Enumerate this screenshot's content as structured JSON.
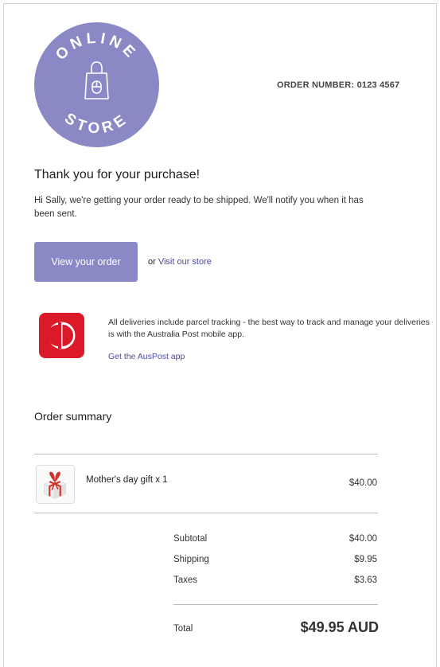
{
  "brand": {
    "logo_top_text": "ONLINE",
    "logo_bottom_text": "STORE",
    "logo_color": "#8a88c5"
  },
  "order_number_text": "ORDER NUMBER: 0123 4567",
  "heading": "Thank you for your purchase!",
  "intro_text": "Hi Sally, we're getting your order ready to be shipped. We'll notify you when it has been sent.",
  "cta": {
    "button_label": "View your order",
    "or_text": "or",
    "visit_store_link": "Visit our store"
  },
  "delivery": {
    "icon": "auspost-logo-icon",
    "icon_color": "#dc1928",
    "text": "All deliveries include parcel tracking - the best way to track and manage your deliveries is with the Australia Post mobile app.",
    "app_link": "Get the AusPost app"
  },
  "summary": {
    "title": "Order summary",
    "items": [
      {
        "icon": "gift-box-icon",
        "name": "Mother's day gift x 1",
        "price": "$40.00"
      }
    ],
    "subtotal_label": "Subtotal",
    "subtotal_value": "$40.00",
    "shipping_label": "Shipping",
    "shipping_value": "$9.95",
    "taxes_label": "Taxes",
    "taxes_value": "$3.63",
    "total_label": "Total",
    "total_value": "$49.95 AUD"
  },
  "colors": {
    "accent": "#8a88c5",
    "link": "#4a48a8"
  }
}
